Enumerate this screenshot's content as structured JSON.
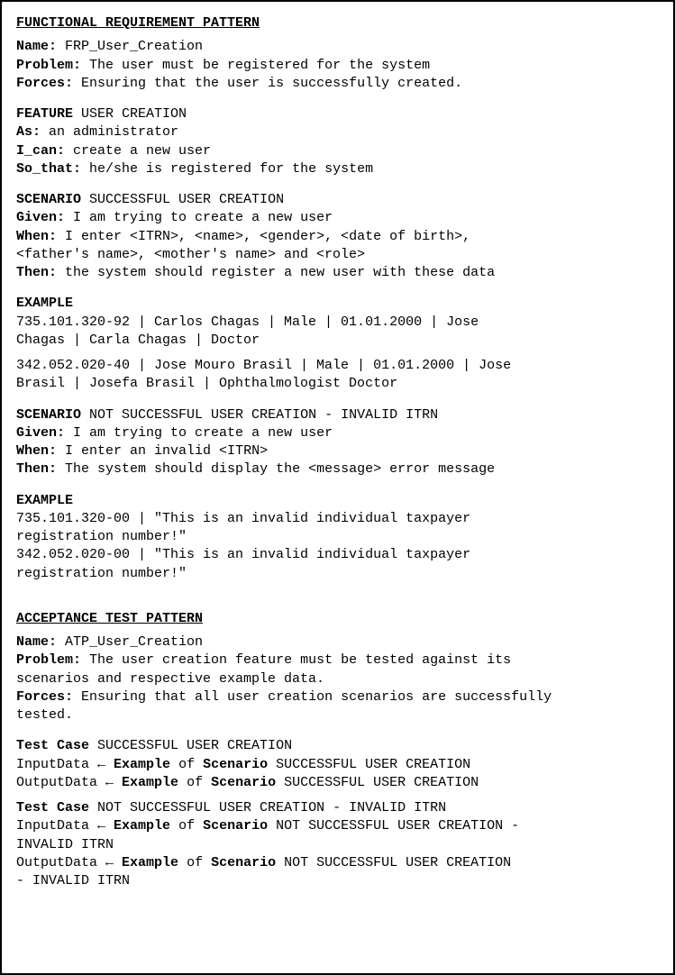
{
  "frp": {
    "heading": "FUNCTIONAL REQUIREMENT PATTERN",
    "name_label": "Name:",
    "name_value": "FRP_User_Creation",
    "problem_label": "Problem:",
    "problem_value": "The user must be registered for the system",
    "forces_label": "Forces:",
    "forces_value": "Ensuring that the user is successfully created.",
    "feature_kw": "FEATURE",
    "feature_name": "USER CREATION",
    "as_label": "As:",
    "as_value": "an administrator",
    "ican_label": "I_can:",
    "ican_value": "create a new user",
    "sothat_label": "So_that:",
    "sothat_value": "he/she is registered for the system",
    "scenario_kw": "SCENARIO",
    "scenario1_name": "SUCCESSFUL USER CREATION",
    "given_label": "Given:",
    "s1_given": "I am trying to create a new user",
    "when_label": "When:",
    "s1_when_l1": "I enter <ITRN>, <name>, <gender>, <date of birth>,",
    "s1_when_l2": "<father's name>, <mother's name> and <role>",
    "then_label": "Then:",
    "s1_then": "the system should register a new user with these data",
    "example_kw": "EXAMPLE",
    "s1_ex1_l1": "735.101.320-92 | Carlos Chagas | Male | 01.01.2000 | Jose",
    "s1_ex1_l2": "Chagas | Carla Chagas | Doctor",
    "s1_ex2_l1": "342.052.020-40 | Jose Mouro Brasil | Male | 01.01.2000 | Jose",
    "s1_ex2_l2": "Brasil | Josefa Brasil | Ophthalmologist Doctor",
    "scenario2_name": "NOT SUCCESSFUL USER CREATION - INVALID ITRN",
    "s2_given": "I am trying to create a new user",
    "s2_when": "I enter an invalid <ITRN>",
    "s2_then": "The system should display the <message> error message",
    "s2_ex1_l1": "735.101.320-00 | \"This is an invalid individual taxpayer",
    "s2_ex1_l2": "registration number!\"",
    "s2_ex2_l1": "342.052.020-00 | \"This is an invalid individual taxpayer",
    "s2_ex2_l2": "registration number!\""
  },
  "atp": {
    "heading": "ACCEPTANCE TEST PATTERN",
    "name_label": "Name:",
    "name_value": "ATP_User_Creation",
    "problem_label": "Problem:",
    "problem_l1": "The user creation feature must be tested against its",
    "problem_l2": "scenarios and respective example data.",
    "forces_label": "Forces:",
    "forces_l1": "Ensuring that all user creation scenarios are successfully",
    "forces_l2": "tested.",
    "testcase_kw": "Test Case",
    "tc1_name": "SUCCESSFUL USER CREATION",
    "input_label": "InputData ←",
    "output_label": "OutputData ←",
    "example_kw": "Example",
    "of_kw": "of",
    "scenario_kw": "Scenario",
    "tc1_scenario": "SUCCESSFUL USER CREATION",
    "tc2_name": "NOT SUCCESSFUL USER CREATION - INVALID ITRN",
    "tc2_scenario_l1": "NOT SUCCESSFUL USER CREATION -",
    "tc2_scenario_l2": "INVALID ITRN",
    "tc2_out_scenario_l1": "NOT SUCCESSFUL USER CREATION",
    "tc2_out_scenario_l2": "- INVALID ITRN"
  }
}
